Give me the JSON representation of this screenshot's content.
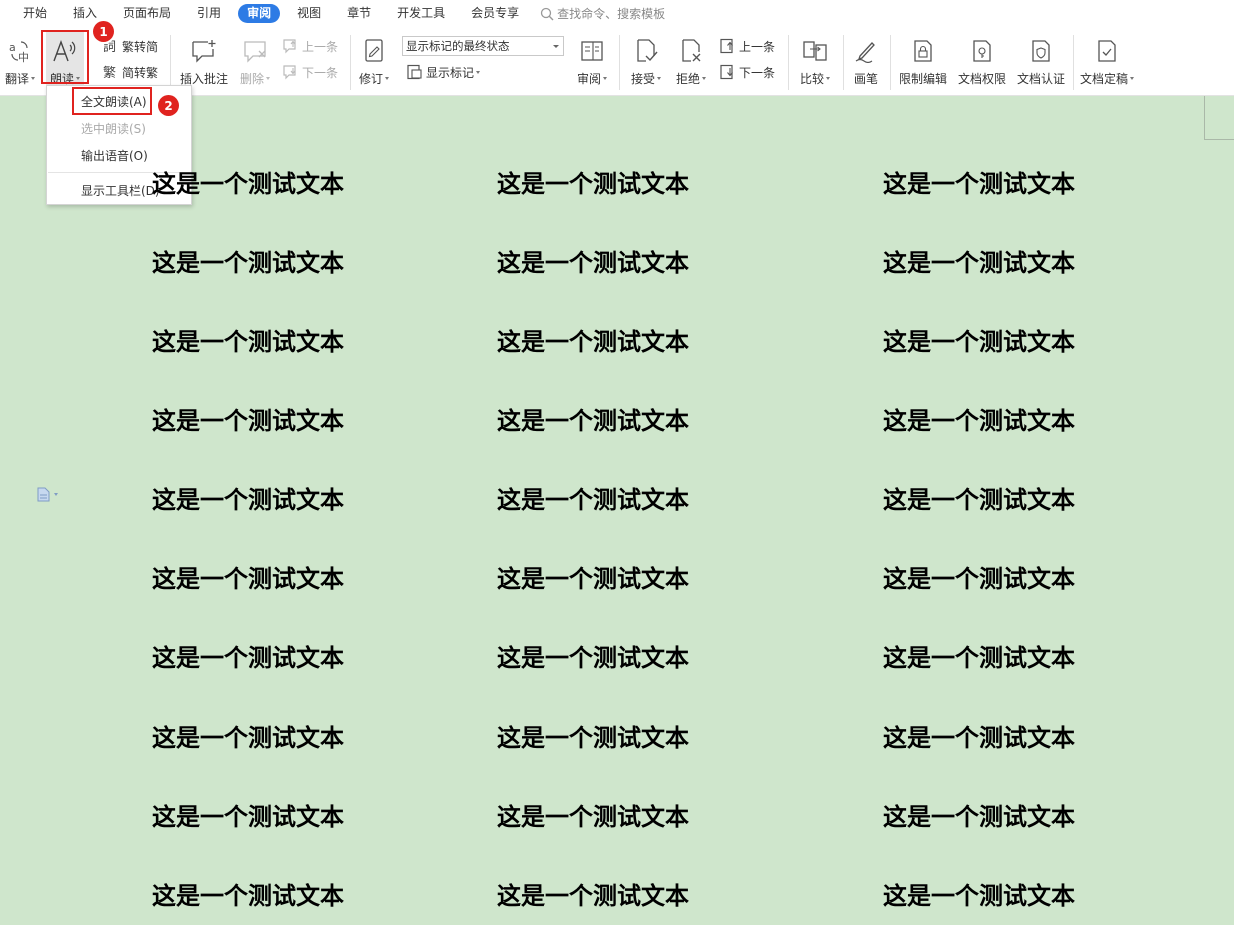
{
  "menu": {
    "tabs": [
      "开始",
      "插入",
      "页面布局",
      "引用",
      "审阅",
      "视图",
      "章节",
      "开发工具",
      "会员专享"
    ],
    "active_tab": "审阅",
    "search_placeholder": "查找命令、搜索模板"
  },
  "ribbon": {
    "translate": "翻译",
    "read_aloud": "朗读",
    "trad_to_simp": "繁转简",
    "simp_to_trad": "简转繁",
    "insert_comment": "插入批注",
    "delete": "删除",
    "prev_comment": "上一条",
    "next_comment": "下一条",
    "track_changes": "修订",
    "display_mode": "显示标记的最终状态",
    "show_markup": "显示标记",
    "review": "审阅",
    "accept": "接受",
    "reject": "拒绝",
    "prev_change": "上一条",
    "next_change": "下一条",
    "compare": "比较",
    "ink": "画笔",
    "restrict_editing": "限制编辑",
    "doc_permissions": "文档权限",
    "doc_certification": "文档认证",
    "doc_finalize": "文档定稿"
  },
  "callouts": {
    "step1": "1",
    "step2": "2"
  },
  "dropdown": {
    "read_all": "全文朗读(A)",
    "read_selection": "选中朗读(S)",
    "output_speech": "输出语音(O)",
    "show_toolbar": "显示工具栏(D)"
  },
  "document": {
    "sample_text": "这是一个测试文本"
  },
  "colors": {
    "accent": "#2d7be5",
    "highlight_red": "#e0231f",
    "page_background": "#cfe6cc"
  }
}
